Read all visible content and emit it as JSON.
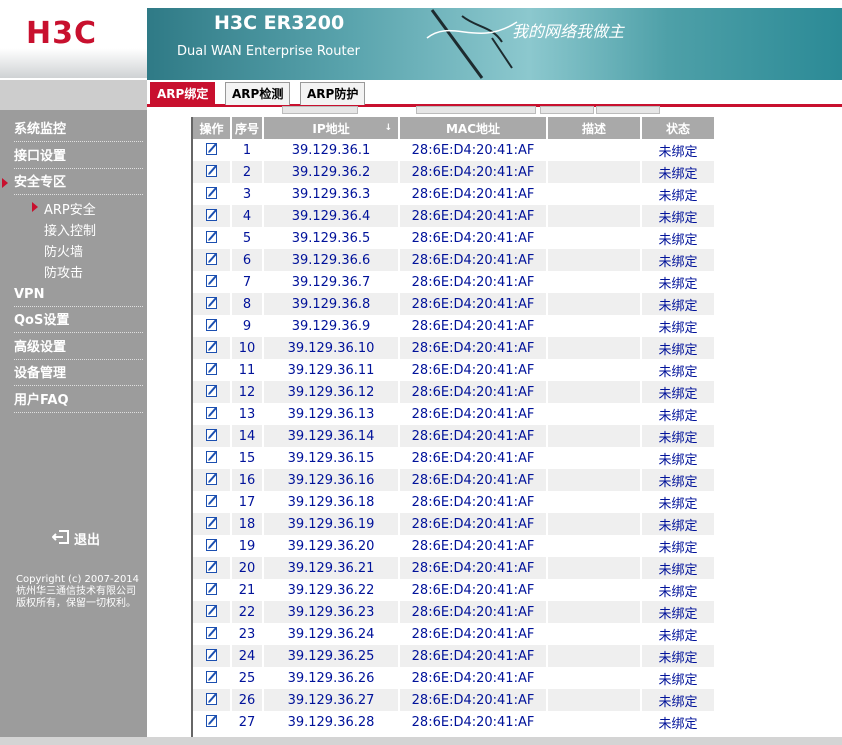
{
  "header": {
    "logo": "H3C",
    "model": "H3C ER3200",
    "subtitle": "Dual WAN Enterprise Router",
    "slogan": "我的网络我做主"
  },
  "sidebar": {
    "items": [
      {
        "label": "系统监控"
      },
      {
        "label": "接口设置"
      },
      {
        "label": "安全专区"
      },
      {
        "label": "VPN"
      },
      {
        "label": "QoS设置"
      },
      {
        "label": "高级设置"
      },
      {
        "label": "设备管理"
      },
      {
        "label": "用户FAQ"
      }
    ],
    "subitems": [
      {
        "label": "ARP安全"
      },
      {
        "label": "接入控制"
      },
      {
        "label": "防火墙"
      },
      {
        "label": "防攻击"
      }
    ],
    "logout_label": "退出",
    "copyright": "Copyright (c) 2007-2014 杭州华三通信技术有限公司 版权所有，保留一切权利。"
  },
  "tabs": [
    {
      "label": "ARP绑定"
    },
    {
      "label": "ARP检测"
    },
    {
      "label": "ARP防护"
    }
  ],
  "table": {
    "headers": [
      "操作",
      "序号",
      "IP地址",
      "MAC地址",
      "描述",
      "状态"
    ],
    "rows": [
      {
        "no": "1",
        "ip": "39.129.36.1",
        "mac": "28:6E:D4:20:41:AF",
        "desc": "",
        "status": "未绑定"
      },
      {
        "no": "2",
        "ip": "39.129.36.2",
        "mac": "28:6E:D4:20:41:AF",
        "desc": "",
        "status": "未绑定"
      },
      {
        "no": "3",
        "ip": "39.129.36.3",
        "mac": "28:6E:D4:20:41:AF",
        "desc": "",
        "status": "未绑定"
      },
      {
        "no": "4",
        "ip": "39.129.36.4",
        "mac": "28:6E:D4:20:41:AF",
        "desc": "",
        "status": "未绑定"
      },
      {
        "no": "5",
        "ip": "39.129.36.5",
        "mac": "28:6E:D4:20:41:AF",
        "desc": "",
        "status": "未绑定"
      },
      {
        "no": "6",
        "ip": "39.129.36.6",
        "mac": "28:6E:D4:20:41:AF",
        "desc": "",
        "status": "未绑定"
      },
      {
        "no": "7",
        "ip": "39.129.36.7",
        "mac": "28:6E:D4:20:41:AF",
        "desc": "",
        "status": "未绑定"
      },
      {
        "no": "8",
        "ip": "39.129.36.8",
        "mac": "28:6E:D4:20:41:AF",
        "desc": "",
        "status": "未绑定"
      },
      {
        "no": "9",
        "ip": "39.129.36.9",
        "mac": "28:6E:D4:20:41:AF",
        "desc": "",
        "status": "未绑定"
      },
      {
        "no": "10",
        "ip": "39.129.36.10",
        "mac": "28:6E:D4:20:41:AF",
        "desc": "",
        "status": "未绑定"
      },
      {
        "no": "11",
        "ip": "39.129.36.11",
        "mac": "28:6E:D4:20:41:AF",
        "desc": "",
        "status": "未绑定"
      },
      {
        "no": "12",
        "ip": "39.129.36.12",
        "mac": "28:6E:D4:20:41:AF",
        "desc": "",
        "status": "未绑定"
      },
      {
        "no": "13",
        "ip": "39.129.36.13",
        "mac": "28:6E:D4:20:41:AF",
        "desc": "",
        "status": "未绑定"
      },
      {
        "no": "14",
        "ip": "39.129.36.14",
        "mac": "28:6E:D4:20:41:AF",
        "desc": "",
        "status": "未绑定"
      },
      {
        "no": "15",
        "ip": "39.129.36.15",
        "mac": "28:6E:D4:20:41:AF",
        "desc": "",
        "status": "未绑定"
      },
      {
        "no": "16",
        "ip": "39.129.36.16",
        "mac": "28:6E:D4:20:41:AF",
        "desc": "",
        "status": "未绑定"
      },
      {
        "no": "17",
        "ip": "39.129.36.18",
        "mac": "28:6E:D4:20:41:AF",
        "desc": "",
        "status": "未绑定"
      },
      {
        "no": "18",
        "ip": "39.129.36.19",
        "mac": "28:6E:D4:20:41:AF",
        "desc": "",
        "status": "未绑定"
      },
      {
        "no": "19",
        "ip": "39.129.36.20",
        "mac": "28:6E:D4:20:41:AF",
        "desc": "",
        "status": "未绑定"
      },
      {
        "no": "20",
        "ip": "39.129.36.21",
        "mac": "28:6E:D4:20:41:AF",
        "desc": "",
        "status": "未绑定"
      },
      {
        "no": "21",
        "ip": "39.129.36.22",
        "mac": "28:6E:D4:20:41:AF",
        "desc": "",
        "status": "未绑定"
      },
      {
        "no": "22",
        "ip": "39.129.36.23",
        "mac": "28:6E:D4:20:41:AF",
        "desc": "",
        "status": "未绑定"
      },
      {
        "no": "23",
        "ip": "39.129.36.24",
        "mac": "28:6E:D4:20:41:AF",
        "desc": "",
        "status": "未绑定"
      },
      {
        "no": "24",
        "ip": "39.129.36.25",
        "mac": "28:6E:D4:20:41:AF",
        "desc": "",
        "status": "未绑定"
      },
      {
        "no": "25",
        "ip": "39.129.36.26",
        "mac": "28:6E:D4:20:41:AF",
        "desc": "",
        "status": "未绑定"
      },
      {
        "no": "26",
        "ip": "39.129.36.27",
        "mac": "28:6E:D4:20:41:AF",
        "desc": "",
        "status": "未绑定"
      },
      {
        "no": "27",
        "ip": "39.129.36.28",
        "mac": "28:6E:D4:20:41:AF",
        "desc": "",
        "status": "未绑定"
      }
    ]
  },
  "icons": {
    "edit": "edit-icon",
    "sort": "sort-desc-icon",
    "logout": "logout-icon"
  },
  "colors": {
    "brand_red": "#c8102e",
    "sidebar_bg": "#9c9c9c",
    "table_header_bg": "#a9a9a9",
    "link_blue": "#00129a"
  }
}
